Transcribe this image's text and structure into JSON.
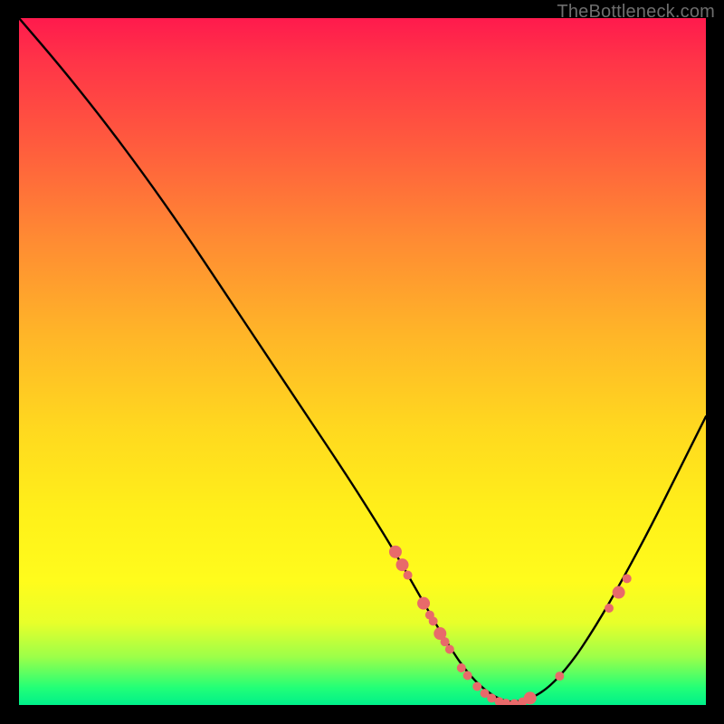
{
  "watermark": "TheBottleneck.com",
  "chart_data": {
    "type": "line",
    "title": "",
    "xlabel": "",
    "ylabel": "",
    "xlim": [
      0,
      100
    ],
    "ylim": [
      0,
      100
    ],
    "curve": {
      "name": "bottleneck-curve",
      "x": [
        0,
        6,
        12,
        18,
        24,
        30,
        36,
        42,
        48,
        54,
        58,
        62,
        65.5,
        69,
        72,
        76,
        80,
        84,
        88,
        92,
        96,
        100
      ],
      "y": [
        100,
        93,
        85.5,
        77.5,
        69,
        60,
        51,
        42,
        33,
        23.5,
        16.5,
        9.5,
        4.3,
        1.2,
        0.2,
        1.5,
        5.5,
        11.5,
        18.5,
        26,
        34,
        42
      ]
    },
    "markers": {
      "name": "data-points",
      "color": "#e86a6a",
      "radius_small": 5,
      "radius_large": 7,
      "points": [
        {
          "x": 54.8,
          "y": 22.3,
          "r": "large"
        },
        {
          "x": 55.8,
          "y": 20.4,
          "r": "large"
        },
        {
          "x": 56.6,
          "y": 18.9,
          "r": "small"
        },
        {
          "x": 58.9,
          "y": 14.8,
          "r": "large"
        },
        {
          "x": 59.8,
          "y": 13.1,
          "r": "small"
        },
        {
          "x": 60.3,
          "y": 12.2,
          "r": "small"
        },
        {
          "x": 61.3,
          "y": 10.4,
          "r": "large"
        },
        {
          "x": 62.0,
          "y": 9.2,
          "r": "small"
        },
        {
          "x": 62.7,
          "y": 8.1,
          "r": "small"
        },
        {
          "x": 64.4,
          "y": 5.4,
          "r": "small"
        },
        {
          "x": 65.3,
          "y": 4.3,
          "r": "small"
        },
        {
          "x": 66.7,
          "y": 2.7,
          "r": "small"
        },
        {
          "x": 67.8,
          "y": 1.7,
          "r": "small"
        },
        {
          "x": 68.8,
          "y": 1.0,
          "r": "small"
        },
        {
          "x": 69.9,
          "y": 0.5,
          "r": "small"
        },
        {
          "x": 70.9,
          "y": 0.25,
          "r": "small"
        },
        {
          "x": 72.1,
          "y": 0.2,
          "r": "small"
        },
        {
          "x": 73.3,
          "y": 0.45,
          "r": "small"
        },
        {
          "x": 74.4,
          "y": 1.0,
          "r": "large"
        },
        {
          "x": 78.7,
          "y": 4.2,
          "r": "small"
        },
        {
          "x": 85.9,
          "y": 14.1,
          "r": "small"
        },
        {
          "x": 87.3,
          "y": 16.4,
          "r": "large"
        },
        {
          "x": 88.5,
          "y": 18.4,
          "r": "small"
        }
      ]
    }
  }
}
